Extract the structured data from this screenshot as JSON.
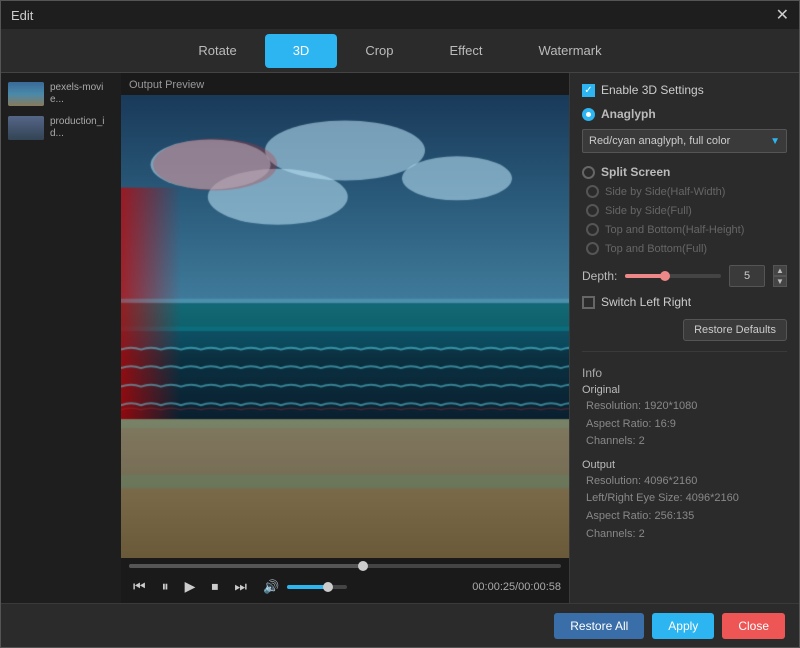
{
  "window": {
    "title": "Edit",
    "close_label": "✕"
  },
  "tabs": [
    {
      "label": "Rotate",
      "id": "rotate",
      "active": false
    },
    {
      "label": "3D",
      "id": "3d",
      "active": true
    },
    {
      "label": "Crop",
      "id": "crop",
      "active": false
    },
    {
      "label": "Effect",
      "id": "effect",
      "active": false
    },
    {
      "label": "Watermark",
      "id": "watermark",
      "active": false
    }
  ],
  "sidebar": {
    "items": [
      {
        "label": "pexels-movie..."
      },
      {
        "label": "production_id..."
      }
    ]
  },
  "video": {
    "preview_label": "Output Preview",
    "time_display": "00:00:25/00:00:58"
  },
  "settings": {
    "enable_3d_label": "Enable 3D Settings",
    "anaglyph_label": "Anaglyph",
    "dropdown_value": "Red/cyan anaglyph, full color",
    "split_screen_label": "Split Screen",
    "sub_options": [
      {
        "label": "Side by Side(Half-Width)",
        "selected": false,
        "disabled": true
      },
      {
        "label": "Side by Side(Full)",
        "selected": false,
        "disabled": true
      },
      {
        "label": "Top and Bottom(Half-Height)",
        "selected": false,
        "disabled": true
      },
      {
        "label": "Top and Bottom(Full)",
        "selected": false,
        "disabled": true
      }
    ],
    "depth_label": "Depth:",
    "depth_value": "5",
    "switch_left_right_label": "Switch Left Right",
    "restore_defaults_label": "Restore Defaults"
  },
  "info": {
    "title": "Info",
    "original_label": "Original",
    "original_lines": [
      "Resolution: 1920*1080",
      "Aspect Ratio: 16:9",
      "Channels: 2"
    ],
    "output_label": "Output",
    "output_lines": [
      "Resolution: 4096*2160",
      "Left/Right Eye Size: 4096*2160",
      "Aspect Ratio: 256:135",
      "Channels: 2"
    ]
  },
  "bottom": {
    "restore_all_label": "Restore All",
    "apply_label": "Apply",
    "close_label": "Close"
  }
}
